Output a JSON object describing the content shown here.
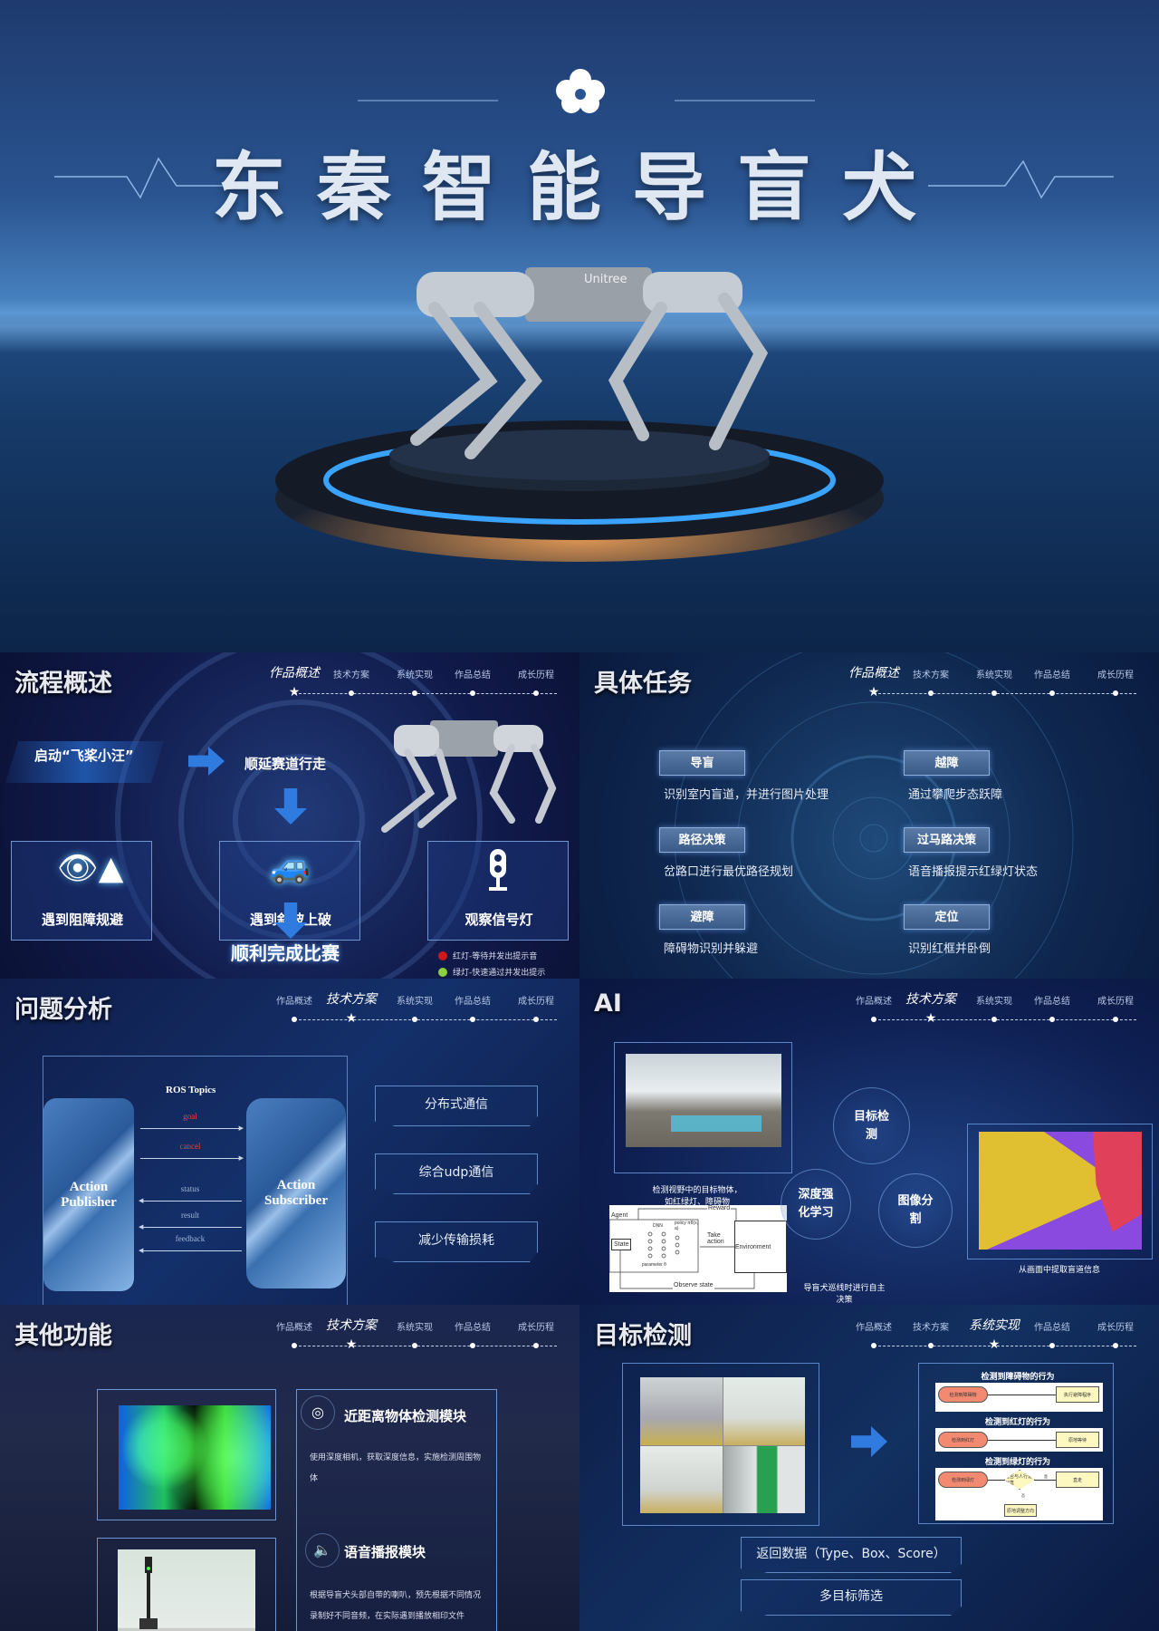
{
  "hero": {
    "title": "东秦智能导盲犬",
    "robot_brand": "Unitree",
    "logo": "flower-logo"
  },
  "nav": {
    "items": [
      "作品概述",
      "技术方案",
      "系统实现",
      "作品总结",
      "成长历程"
    ]
  },
  "colors": {
    "accent": "#2f7be0",
    "bg": "#0a1533",
    "red_light": "#d01818",
    "green_light": "#8cd03c"
  },
  "flow": {
    "title": "流程概述",
    "active_nav": 0,
    "start": "启动“飞桨小汪”",
    "step1": "顺延赛道行走",
    "boxes": [
      {
        "icon": "eye-cone-icon",
        "label": "遇到阻障规避"
      },
      {
        "icon": "car-slope-icon",
        "label": "遇到斜坡上破"
      },
      {
        "icon": "traffic-light-icon",
        "label": "观察信号灯"
      }
    ],
    "legend": [
      "红灯-等待并发出提示音",
      "绿灯-快速通过并发出提示"
    ],
    "finish": "顺利完成比赛"
  },
  "tasks": {
    "title": "具体任务",
    "active_nav": 0,
    "items": [
      {
        "tag": "导盲",
        "desc": "识别室内盲道，并进行图片处理"
      },
      {
        "tag": "越障",
        "desc": "通过攀爬步态跃障"
      },
      {
        "tag": "路径决策",
        "desc": "岔路口进行最优路径规划"
      },
      {
        "tag": "过马路决策",
        "desc": "语音播报提示红绿灯状态"
      },
      {
        "tag": "避障",
        "desc": "障碍物识别并躲避"
      },
      {
        "tag": "定位",
        "desc": "识别红框并卧倒"
      }
    ]
  },
  "problem": {
    "title": "问题分析",
    "active_nav": 1,
    "diagram_title": "ROS Topics",
    "publisher": "Action Publisher",
    "subscriber": "Action Subscriber",
    "forward": [
      "goal",
      "cancel"
    ],
    "backward": [
      "status",
      "result",
      "feedback"
    ],
    "points": [
      "分布式通信",
      "综合udp通信",
      "减少传输损耗"
    ]
  },
  "ai": {
    "title": "AI",
    "active_nav": 1,
    "circles": [
      "目标检测",
      "深度强化学习",
      "图像分割"
    ],
    "caption_detect": "检测视野中的目标物体，如红绿灯、障碍物",
    "caption_seg": "从画面中提取盲道信息",
    "caption_rl": "导盲犬巡线时进行自主决策",
    "rl": {
      "reward": "Reward",
      "agent": "Agent",
      "dnn": "DNN",
      "policy": "policy πθ(s, a)",
      "state": "State",
      "take_action": "Take action",
      "environment": "Environment",
      "parameter": "parameter θ",
      "observe": "Observe state"
    }
  },
  "other": {
    "title": "其他功能",
    "active_nav": 1,
    "modules": [
      {
        "icon": "camera-icon",
        "name": "近距离物体检测模块",
        "desc": "使用深度相机，获取深度信息，实施检测周围物体"
      },
      {
        "icon": "speaker-icon",
        "name": "语音播报模块",
        "desc": "根据导盲犬头部自带的喇叭，预先根据不同情况录制好不同音频，在实际遇到播放相印文件"
      }
    ]
  },
  "detect": {
    "title": "目标检测",
    "active_nav": 2,
    "flows": [
      {
        "title": "检测到障碍物的行为",
        "from": "检测到障碍物",
        "to": "执行避障程序"
      },
      {
        "title": "检测到红灯的行为",
        "from": "检测到红灯",
        "to": "原地等待"
      },
      {
        "title": "检测到绿灯的行为",
        "from": "检测到绿灯",
        "decision": "是否与人行道对直",
        "yes": "是",
        "no": "否",
        "to": "直走",
        "adjust": "原地调整方向"
      }
    ],
    "pills": [
      "返回数据（Type、Box、Score）",
      "多目标筛选"
    ]
  }
}
